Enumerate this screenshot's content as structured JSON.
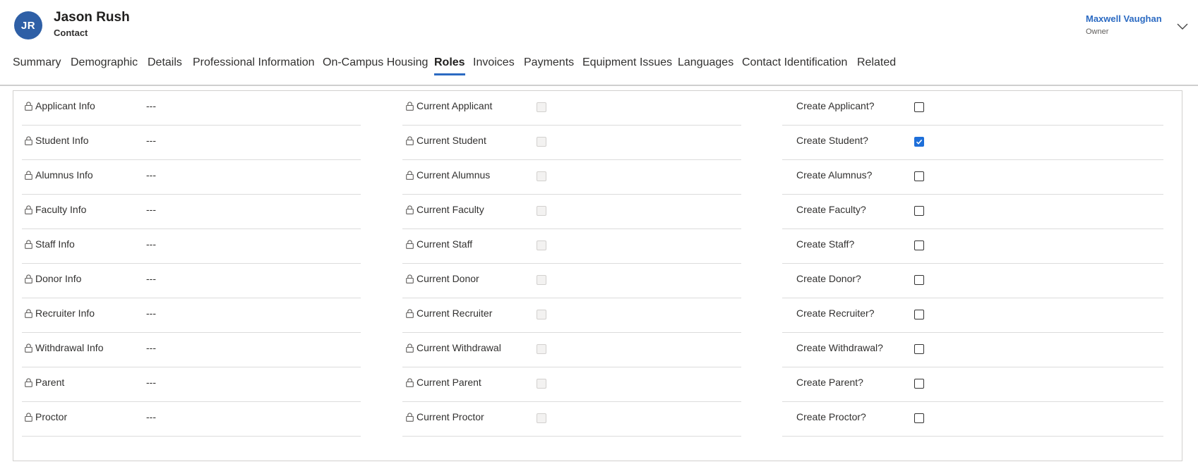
{
  "record": {
    "initials": "JR",
    "name": "Jason Rush",
    "entity_type": "Contact",
    "owner_name": "Maxwell Vaughan",
    "owner_label": "Owner"
  },
  "tabs": [
    {
      "label": "Summary",
      "active": false
    },
    {
      "label": "Demographic",
      "active": false
    },
    {
      "label": "Details",
      "active": false
    },
    {
      "label": "Professional Information",
      "active": false
    },
    {
      "label": "On-Campus Housing",
      "active": false
    },
    {
      "label": "Roles",
      "active": true
    },
    {
      "label": "Invoices",
      "active": false
    },
    {
      "label": "Payments",
      "active": false
    },
    {
      "label": "Equipment Issues",
      "active": false
    },
    {
      "label": "Languages",
      "active": false
    },
    {
      "label": "Contact Identification",
      "active": false
    },
    {
      "label": "Related",
      "active": false
    }
  ],
  "info_fields": [
    {
      "label": "Applicant Info",
      "value": "---"
    },
    {
      "label": "Student Info",
      "value": "---"
    },
    {
      "label": "Alumnus Info",
      "value": "---"
    },
    {
      "label": "Faculty Info",
      "value": "---"
    },
    {
      "label": "Staff Info",
      "value": "---"
    },
    {
      "label": "Donor Info",
      "value": "---"
    },
    {
      "label": "Recruiter Info",
      "value": "---"
    },
    {
      "label": "Withdrawal Info",
      "value": "---"
    },
    {
      "label": "Parent",
      "value": "---"
    },
    {
      "label": "Proctor",
      "value": "---"
    }
  ],
  "current_fields": [
    {
      "label": "Current Applicant",
      "checked": false
    },
    {
      "label": "Current Student",
      "checked": false
    },
    {
      "label": "Current Alumnus",
      "checked": false
    },
    {
      "label": "Current Faculty",
      "checked": false
    },
    {
      "label": "Current Staff",
      "checked": false
    },
    {
      "label": "Current Donor",
      "checked": false
    },
    {
      "label": "Current Recruiter",
      "checked": false
    },
    {
      "label": "Current Withdrawal",
      "checked": false
    },
    {
      "label": "Current Parent",
      "checked": false
    },
    {
      "label": "Current Proctor",
      "checked": false
    }
  ],
  "create_fields": [
    {
      "label": "Create Applicant?",
      "checked": false
    },
    {
      "label": "Create Student?",
      "checked": true
    },
    {
      "label": "Create Alumnus?",
      "checked": false
    },
    {
      "label": "Create Faculty?",
      "checked": false
    },
    {
      "label": "Create Staff?",
      "checked": false
    },
    {
      "label": "Create Donor?",
      "checked": false
    },
    {
      "label": "Create Recruiter?",
      "checked": false
    },
    {
      "label": "Create Withdrawal?",
      "checked": false
    },
    {
      "label": "Create Parent?",
      "checked": false
    },
    {
      "label": "Create Proctor?",
      "checked": false
    }
  ],
  "colors": {
    "accent": "#2b6ac2",
    "avatar_bg": "#2e5fa6",
    "checkbox_checked": "#1e6fd9"
  },
  "icons": {
    "lock": "lock-icon",
    "chevron": "chevron-down-icon",
    "checkmark": "checkmark-icon"
  }
}
